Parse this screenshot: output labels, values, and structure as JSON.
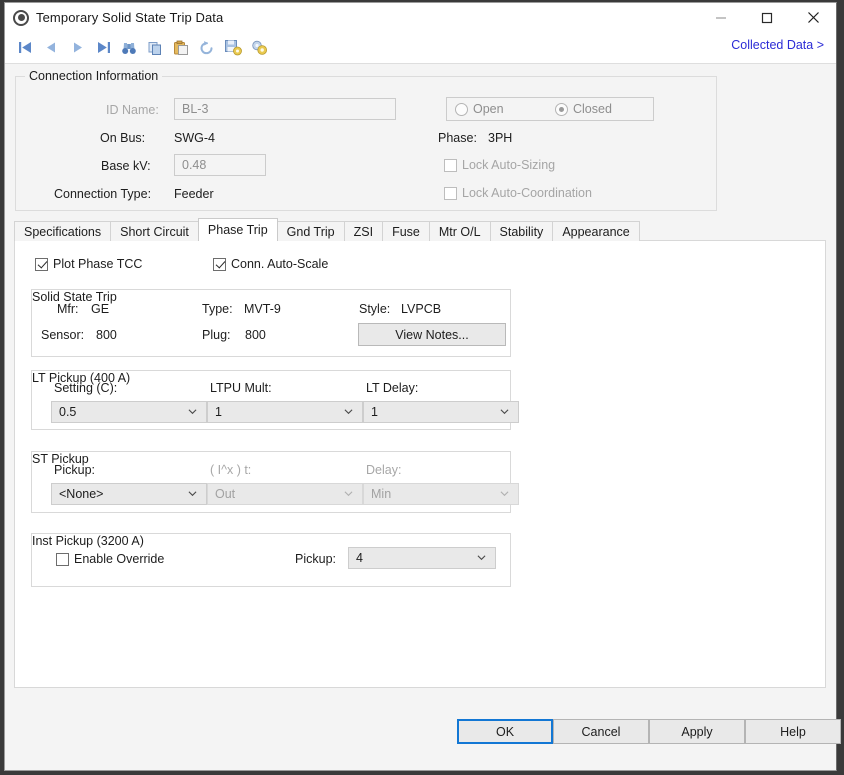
{
  "window": {
    "title": "Temporary Solid State Trip Data",
    "icon": "target-circle-icon",
    "minimize_label": "—",
    "maximize_label": "□",
    "close_label": "✕"
  },
  "toolbar": {
    "icons": [
      {
        "name": "first-record-icon",
        "title": "First"
      },
      {
        "name": "previous-record-icon",
        "title": "Previous"
      },
      {
        "name": "next-record-icon",
        "title": "Next"
      },
      {
        "name": "last-record-icon",
        "title": "Last"
      },
      {
        "name": "find-binoculars-icon",
        "title": "Find"
      },
      {
        "name": "copy-icon",
        "title": "Copy"
      },
      {
        "name": "paste-icon",
        "title": "Paste"
      },
      {
        "name": "refresh-undo-icon",
        "title": "Refresh"
      },
      {
        "name": "save-settings-icon",
        "title": "Save Settings"
      },
      {
        "name": "settings-gear-icon",
        "title": "Settings"
      }
    ],
    "collected_data_link": "Collected Data >",
    "link_color": "#2b2bd6"
  },
  "connection_information": {
    "title": "Connection Information",
    "id_name_label": "ID Name:",
    "id_name_value": "BL-3",
    "on_bus_label": "On Bus:",
    "on_bus_value": "SWG-4",
    "base_kv_label": "Base kV:",
    "base_kv_value": "0.48",
    "connection_type_label": "Connection Type:",
    "connection_type_value": "Feeder",
    "status": {
      "open_label": "Open",
      "open_selected": false,
      "closed_label": "Closed",
      "closed_selected": true
    },
    "phase_label": "Phase:",
    "phase_value": "3PH",
    "lock_auto_sizing_label": "Lock Auto-Sizing",
    "lock_auto_sizing_checked": false,
    "lock_auto_coordination_label": "Lock Auto-Coordination",
    "lock_auto_coordination_checked": false
  },
  "tabs": [
    {
      "label": "Specifications",
      "active": false
    },
    {
      "label": "Short Circuit",
      "active": false
    },
    {
      "label": "Phase Trip",
      "active": true
    },
    {
      "label": "Gnd Trip",
      "active": false
    },
    {
      "label": "ZSI",
      "active": false
    },
    {
      "label": "Fuse",
      "active": false
    },
    {
      "label": "Mtr O/L",
      "active": false
    },
    {
      "label": "Stability",
      "active": false
    },
    {
      "label": "Appearance",
      "active": false
    }
  ],
  "phase_trip": {
    "plot_phase_tcc_label": "Plot Phase TCC",
    "plot_phase_tcc_checked": true,
    "conn_auto_scale_label": "Conn. Auto-Scale",
    "conn_auto_scale_checked": true,
    "solid_state_trip": {
      "title": "Solid State Trip",
      "mfr_label": "Mfr:",
      "mfr_value": "GE",
      "type_label": "Type:",
      "type_value": "MVT-9",
      "style_label": "Style:",
      "style_value": "LVPCB",
      "sensor_label": "Sensor:",
      "sensor_value": "800",
      "plug_label": "Plug:",
      "plug_value": "800",
      "view_notes_label": "View Notes..."
    },
    "lt_pickup": {
      "title": "LT Pickup (400 A)",
      "setting_label": "Setting (C):",
      "setting_value": "0.5",
      "ltpu_mult_label": "LTPU Mult:",
      "ltpu_mult_value": "1",
      "lt_delay_label": "LT Delay:",
      "lt_delay_value": "1"
    },
    "st_pickup": {
      "title": "ST Pickup",
      "pickup_label": "Pickup:",
      "pickup_value": "<None>",
      "ix_t_label": "( I^x ) t:",
      "ix_t_value": "Out",
      "delay_label": "Delay:",
      "delay_value": "Min"
    },
    "inst_pickup": {
      "title": "Inst Pickup (3200 A)",
      "enable_override_label": "Enable Override",
      "enable_override_checked": false,
      "pickup_label": "Pickup:",
      "pickup_value": "4"
    }
  },
  "footer": {
    "ok_label": "OK",
    "cancel_label": "Cancel",
    "apply_label": "Apply",
    "help_label": "Help",
    "default_focus_color": "#1277d4"
  }
}
